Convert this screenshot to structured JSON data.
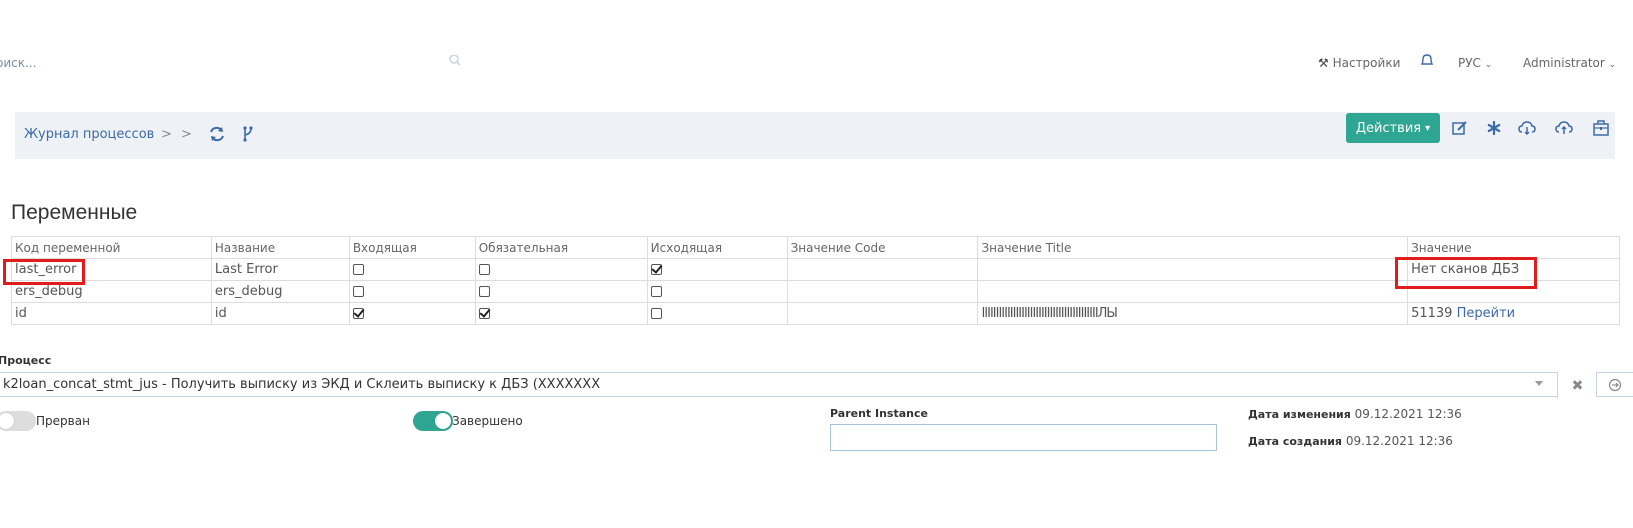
{
  "topbar": {
    "search_placeholder": "оиск...",
    "settings": "Настройки",
    "language": "РУС",
    "user": "Administrator"
  },
  "breadcrumb": {
    "item": "Журнал процессов",
    "sep1": ">",
    "sep2": ">"
  },
  "toolbar": {
    "actions_label": "Действия"
  },
  "section": {
    "title": "Переменные"
  },
  "variables": {
    "columns": [
      "Код переменной",
      "Название",
      "Входящая",
      "Обязательная",
      "Исходящая",
      "Значение Code",
      "Значение Title",
      "Значение"
    ],
    "rows": [
      {
        "code": "last_error",
        "name": "Last Error",
        "incoming": false,
        "required": false,
        "outgoing": true,
        "value_code": "",
        "value_title": "",
        "value": "Нет сканов ДБЗ",
        "link": ""
      },
      {
        "code": "ers_debug",
        "name": "ers_debug",
        "incoming": false,
        "required": false,
        "outgoing": false,
        "value_code": "",
        "value_title": "",
        "value": "",
        "link": ""
      },
      {
        "code": "id",
        "name": "id",
        "incoming": true,
        "required": true,
        "outgoing": false,
        "value_code": "",
        "value_title": "IIIIIIIIIIIIIIIIIIIIIIIIIIIIIIIIIIIIIIIIIЛЫ",
        "value": "51139",
        "link": "Перейти"
      }
    ]
  },
  "process": {
    "label": "Процесс",
    "value": "k2loan_concat_stmt_jus - Получить выписку из ЭКД и Склеить выписку к ДБЗ (XXXXXXX"
  },
  "flags": {
    "interrupted_label": "Прерван",
    "interrupted": false,
    "completed_label": "Завершено",
    "completed": true
  },
  "parent_instance": {
    "label": "Parent Instance",
    "value": ""
  },
  "dates": {
    "modified_label": "Дата изменения",
    "modified": "09.12.2021 12:36",
    "created_label": "Дата создания",
    "created": "09.12.2021 12:36"
  },
  "colors": {
    "accent": "#2fa693",
    "link": "#3d6aa7",
    "highlight": "#e01c1c"
  }
}
